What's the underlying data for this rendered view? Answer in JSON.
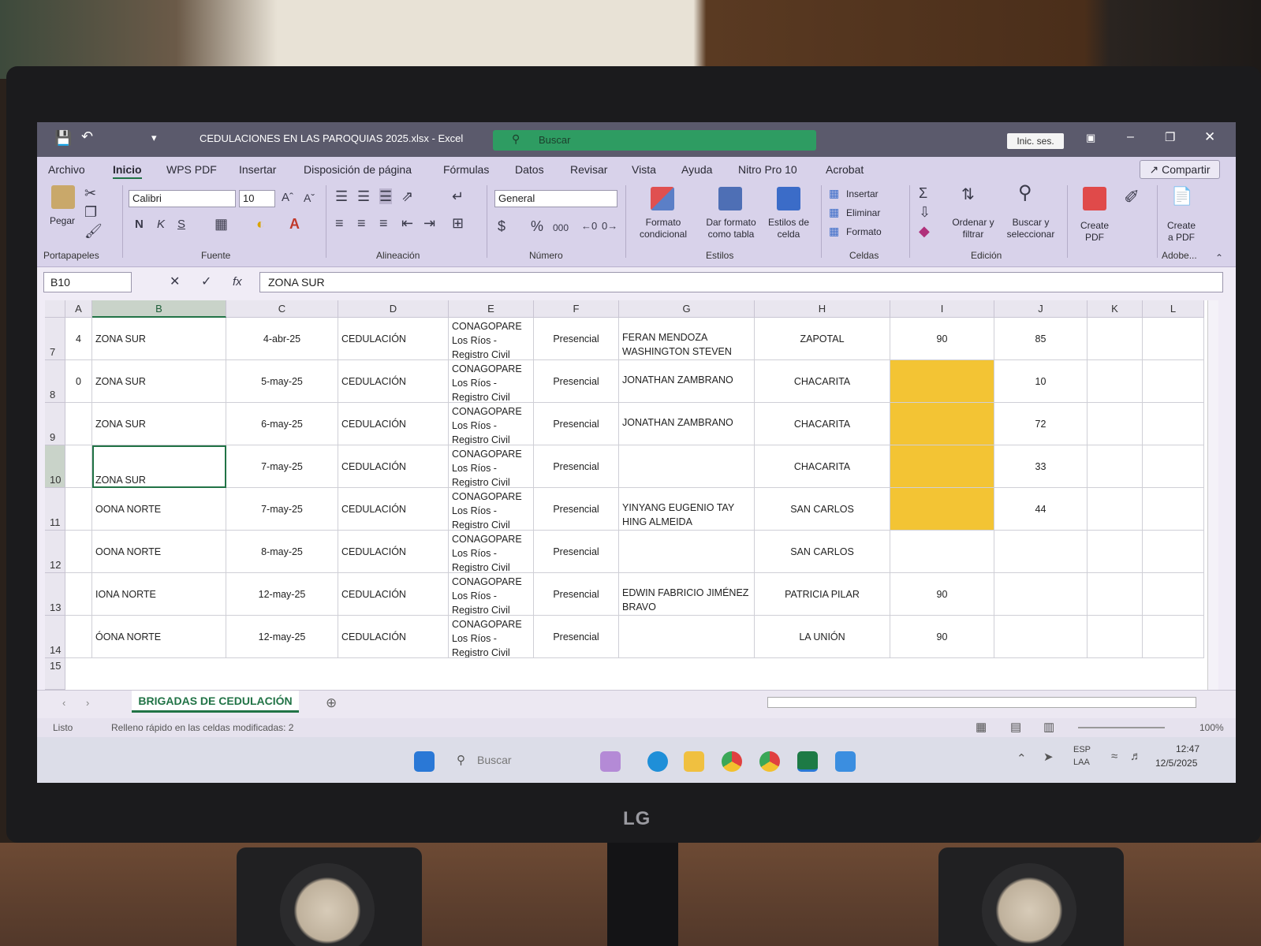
{
  "window": {
    "title": "CEDULACIONES EN LAS PAROQUIAS 2025.xlsx - Excel",
    "search_placeholder": "Buscar",
    "signin_label": "Inic. ses."
  },
  "menu": {
    "items": [
      "Archivo",
      "Inicio",
      "WPS PDF",
      "Insertar",
      "Disposición de página",
      "Fórmulas",
      "Datos",
      "Revisar",
      "Vista",
      "Ayuda",
      "Nitro Pro 10",
      "Acrobat"
    ],
    "share_label": "Compartir"
  },
  "ribbon": {
    "paste_label": "Pegar",
    "clipboard_group": "Portapapeles",
    "font_name": "Calibri",
    "font_size": "10",
    "bold": "N",
    "italic": "K",
    "underline": "S",
    "font_group": "Fuente",
    "alignment_group": "Alineación",
    "number_format": "General",
    "number_group": "Número",
    "cond_format_1": "Formato",
    "cond_format_2": "condicional",
    "table_format_1": "Dar formato",
    "table_format_2": "como tabla",
    "cell_styles_1": "Estilos de",
    "cell_styles_2": "celda",
    "styles_group": "Estilos",
    "insert_label": "Insertar",
    "delete_label": "Eliminar",
    "format_label": "Formato",
    "cells_group": "Celdas",
    "sort_1": "Ordenar y",
    "sort_2": "filtrar",
    "find_1": "Buscar y",
    "find_2": "seleccionar",
    "editing_group": "Edición",
    "create_pdf_1": "Create",
    "create_pdf_2": "PDF",
    "create_apdf_1": "Create",
    "create_apdf_2": "a PDF",
    "adobe_group": "Adobe..."
  },
  "formula_bar": {
    "name_box": "B10",
    "formula": "ZONA SUR"
  },
  "sheet": {
    "columns": [
      "A",
      "B",
      "C",
      "D",
      "E",
      "F",
      "G",
      "H",
      "I",
      "J",
      "K",
      "L"
    ],
    "rows": [
      {
        "num": "7",
        "a": "4",
        "b": "ZONA SUR",
        "c": "4-abr-25",
        "d": "CEDULACIÓN",
        "e": "CONAGOPARE Los Ríos - Registro Civil",
        "f": "Presencial",
        "g": "FERAN MENDOZA WASHINGTON STEVEN",
        "h": "ZAPOTAL",
        "i": "90",
        "j": "85"
      },
      {
        "num": "8",
        "a": "0",
        "b": "ZONA SUR",
        "c": "5-may-25",
        "d": "CEDULACIÓN",
        "e": "CONAGOPARE Los Ríos - Registro Civil",
        "f": "Presencial",
        "g": "JONATHAN ZAMBRANO",
        "h": "CHACARITA",
        "i": "",
        "j": "10"
      },
      {
        "num": "9",
        "a": "",
        "b": "ZONA SUR",
        "c": "6-may-25",
        "d": "CEDULACIÓN",
        "e": "CONAGOPARE Los Ríos - Registro Civil",
        "f": "Presencial",
        "g": "JONATHAN ZAMBRANO",
        "h": "CHACARITA",
        "i": "",
        "j": "72"
      },
      {
        "num": "10",
        "a": "",
        "b": "ZONA SUR",
        "c": "7-may-25",
        "d": "CEDULACIÓN",
        "e": "CONAGOPARE Los Ríos - Registro Civil",
        "f": "Presencial",
        "g": "",
        "h": "CHACARITA",
        "i": "",
        "j": "33"
      },
      {
        "num": "11",
        "a": "",
        "b": "OONA NORTE",
        "c": "7-may-25",
        "d": "CEDULACIÓN",
        "e": "CONAGOPARE Los Ríos - Registro Civil",
        "f": "Presencial",
        "g": "YINYANG EUGENIO TAY HING ALMEIDA",
        "h": "SAN CARLOS",
        "i": "",
        "j": "44"
      },
      {
        "num": "12",
        "a": "",
        "b": "OONA NORTE",
        "c": "8-may-25",
        "d": "CEDULACIÓN",
        "e": "CONAGOPARE Los Ríos - Registro Civil",
        "f": "Presencial",
        "g": "",
        "h": "SAN CARLOS",
        "i": "",
        "j": ""
      },
      {
        "num": "13",
        "a": "",
        "b": "IONA NORTE",
        "c": "12-may-25",
        "d": "CEDULACIÓN",
        "e": "CONAGOPARE Los Ríos - Registro Civil",
        "f": "Presencial",
        "g": "EDWIN FABRICIO JIMÉNEZ BRAVO",
        "h": "PATRICIA PILAR",
        "i": "90",
        "j": ""
      },
      {
        "num": "14",
        "a": "",
        "b": "ÓONA NORTE",
        "c": "12-may-25",
        "d": "CEDULACIÓN",
        "e": "CONAGOPARE Los Ríos - Registro Civil",
        "f": "Presencial",
        "g": "",
        "h": "LA UNIÓN",
        "i": "90",
        "j": ""
      }
    ],
    "next_row_num": "15",
    "highlight_color": "#f3c434"
  },
  "tabs": {
    "active_sheet": "BRIGADAS DE CEDULACIÓN"
  },
  "status": {
    "ready": "Listo",
    "message": "Relleno rápido en  las celdas modificadas: 2",
    "zoom": "100%"
  },
  "taskbar": {
    "search_placeholder": "Buscar",
    "lang_1": "ESP",
    "lang_2": "LAA",
    "time": "12:47",
    "date": "12/5/2025"
  },
  "monitor": {
    "brand": "LG"
  }
}
